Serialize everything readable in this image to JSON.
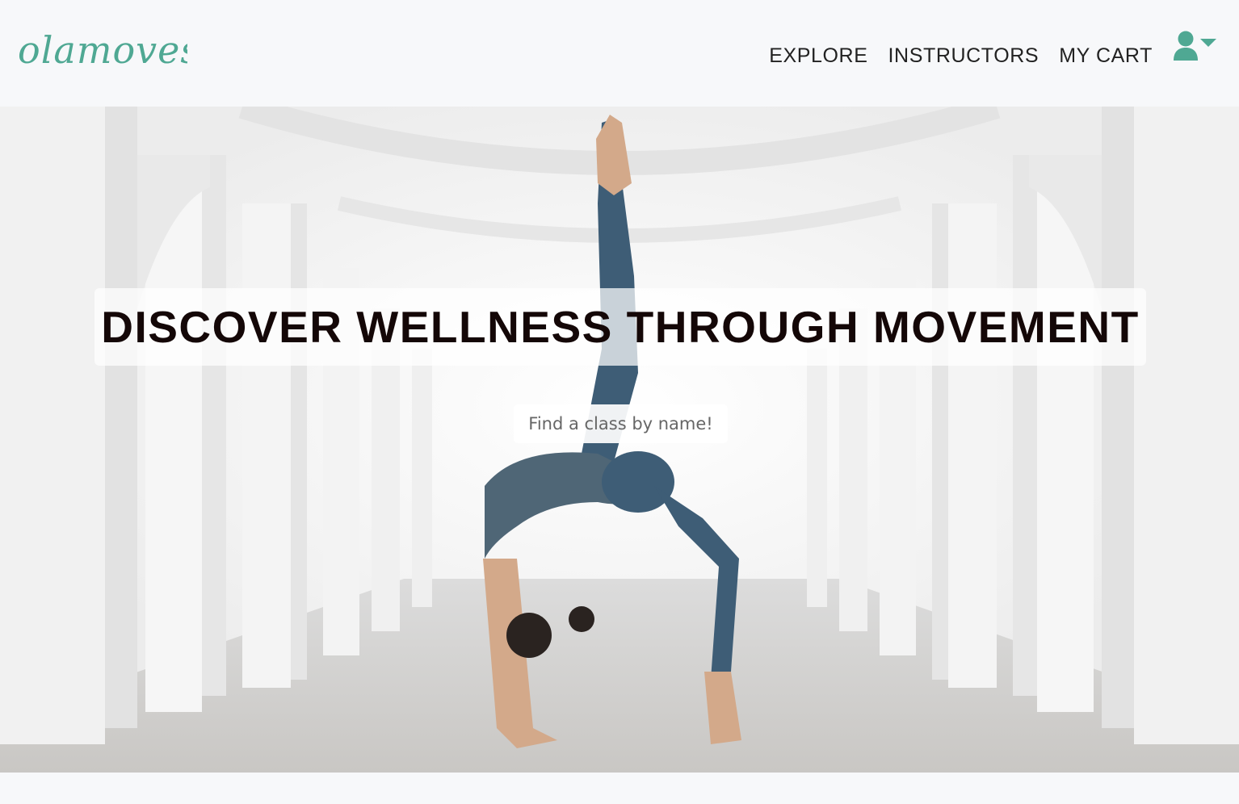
{
  "brand": {
    "logo_text": "olamoves",
    "accent_color": "#4fa893"
  },
  "nav": {
    "items": [
      {
        "label": "EXPLORE"
      },
      {
        "label": "INSTRUCTORS"
      },
      {
        "label": "MY CART"
      }
    ],
    "user_icon": "user-icon",
    "dropdown_icon": "caret-down-icon"
  },
  "hero": {
    "headline": "DISCOVER WELLNESS THROUGH MOVEMENT",
    "search_placeholder": "Find a class by name!",
    "image_subject": "yoga-pose-photo"
  }
}
